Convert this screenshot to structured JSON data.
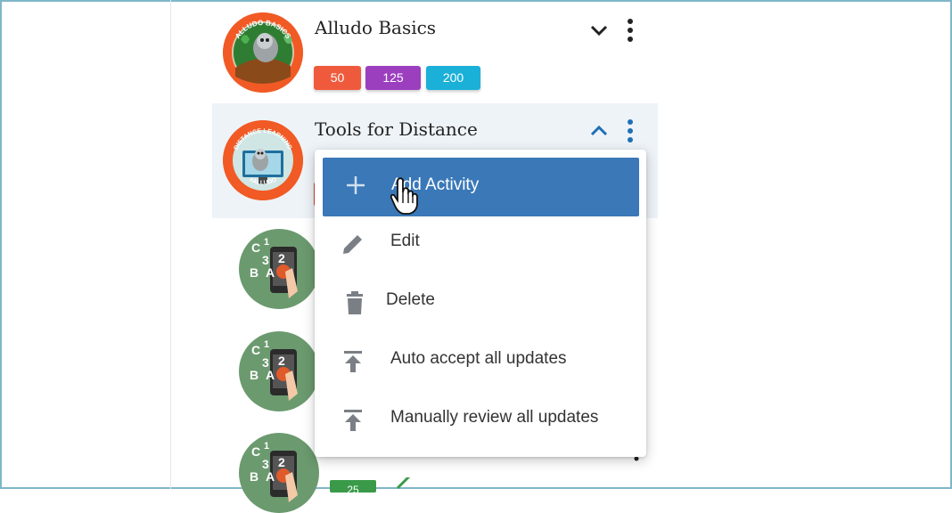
{
  "courses": [
    {
      "title": "Alludo Basics",
      "badge_text": "ALLUDO BASICS",
      "points": [
        "50",
        "125",
        "200"
      ]
    },
    {
      "title": "Tools for Distance",
      "badge_text_top": "DISTANCE LEARNING",
      "badge_text_bottom": "#ALLUDO"
    }
  ],
  "menu": {
    "items": [
      {
        "label": "Add Activity",
        "icon": "plus-icon"
      },
      {
        "label": "Edit",
        "icon": "pencil-icon"
      },
      {
        "label": "Delete",
        "icon": "trash-icon"
      },
      {
        "label": "Auto accept all updates",
        "icon": "upload-icon"
      },
      {
        "label": "Manually review all updates",
        "icon": "upload-icon"
      }
    ]
  },
  "activity_badge": {
    "chars": [
      "C",
      "1",
      "3",
      "2",
      "B",
      "A"
    ]
  },
  "points_colors": [
    "#f05a3c",
    "#9b3fbf",
    "#1ab0d8"
  ],
  "accent": "#3a78b8",
  "bottom_pill": "25"
}
